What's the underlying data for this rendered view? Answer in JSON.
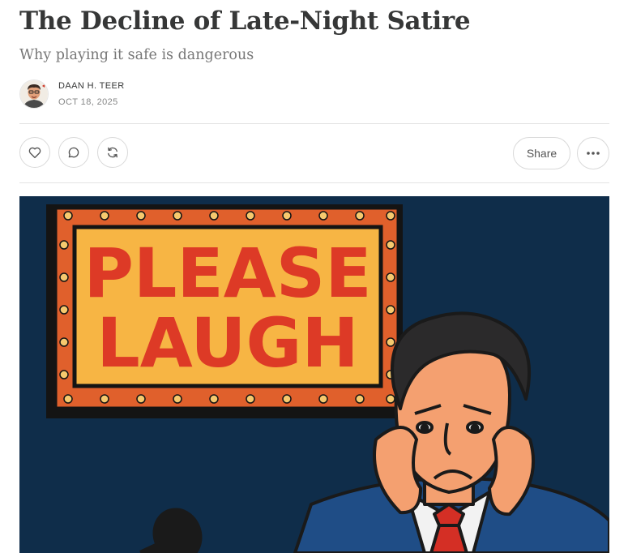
{
  "post": {
    "title": "The Decline of Late-Night Satire",
    "subtitle": "Why playing it safe is dangerous",
    "author": "DAAN H. TEER",
    "date": "OCT 18, 2025"
  },
  "actions": {
    "share_label": "Share",
    "icons": [
      "heart-icon",
      "comment-icon",
      "restack-icon",
      "more-icon"
    ]
  },
  "hero_image": {
    "sign_line1": "PLEASE",
    "sign_line2": "LAUGH",
    "colors": {
      "background": "#0f2d4a",
      "sign_face": "#f7b544",
      "sign_frame": "#e0602c",
      "sign_text": "#dd3a26",
      "bulb": "#f6c96e",
      "skin": "#f4a070",
      "hair": "#2b2a2b",
      "suit": "#1f4d86",
      "tie": "#d42f25"
    }
  }
}
